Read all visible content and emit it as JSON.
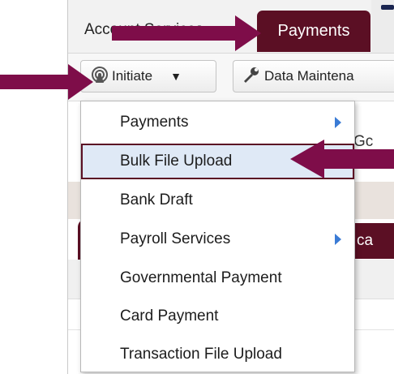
{
  "tabs": {
    "account_label": "Account Services",
    "payments_label": "Payments"
  },
  "toolbar": {
    "initiate_label": "Initiate",
    "data_maintenance_label": "Data Maintena"
  },
  "menu": {
    "items": [
      {
        "label": "Payments",
        "has_submenu": true
      },
      {
        "label": "Bulk File Upload",
        "highlighted": true
      },
      {
        "label": "Bank Draft"
      },
      {
        "label": "Payroll Services",
        "has_submenu": true
      },
      {
        "label": "Governmental Payment"
      },
      {
        "label": "Card Payment"
      },
      {
        "label": "Transaction File Upload"
      }
    ]
  },
  "background": {
    "go_fragment": "Gc",
    "ca_fragment": "ca"
  },
  "colors": {
    "brand_maroon": "#5b0f24",
    "annotation_arrow": "#7e0d49",
    "highlight_bg": "#dfe9f6",
    "submenu_arrow": "#3a7bd5"
  },
  "icons": {
    "initiate": "signal-tower-icon",
    "data_maintenance": "wrench-icon",
    "dropdown": "caret-down-icon",
    "submenu": "triangle-right-icon"
  }
}
